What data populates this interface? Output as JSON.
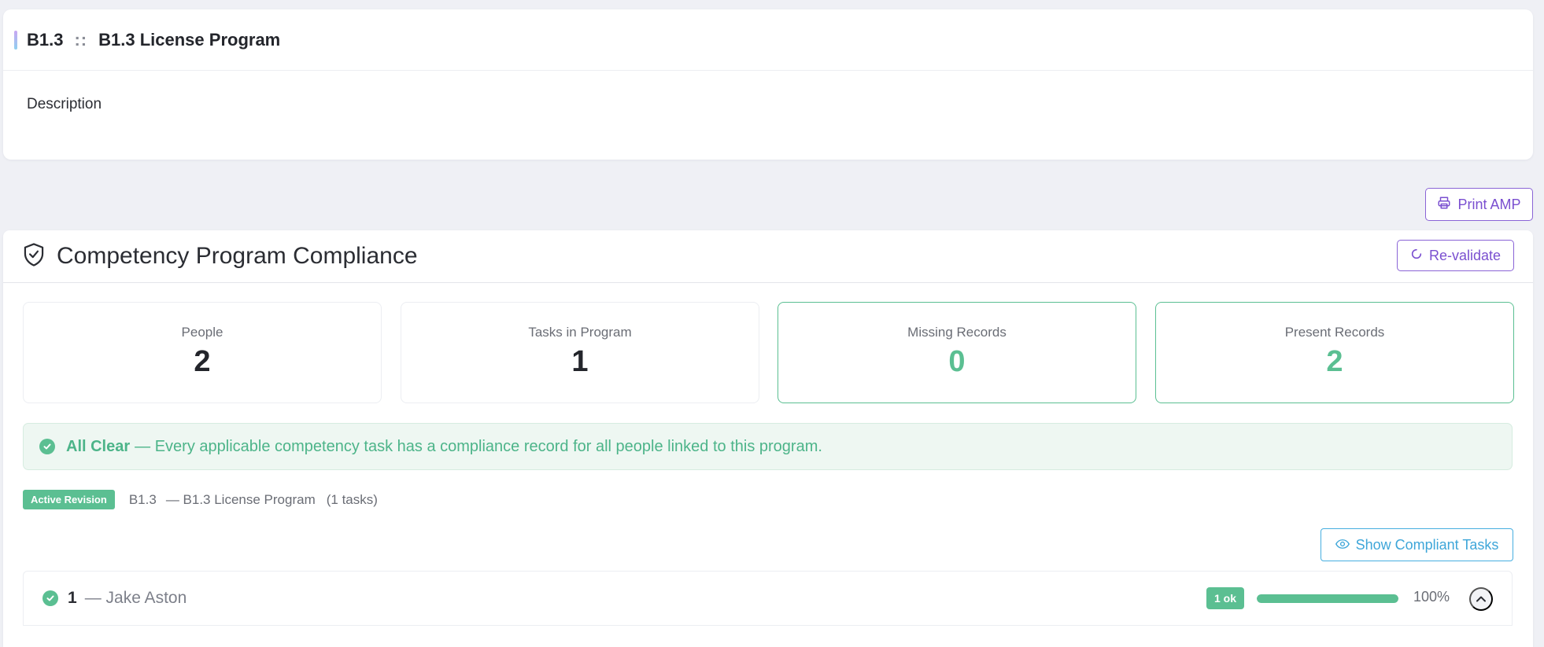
{
  "program": {
    "code": "B1.3",
    "separator": "::",
    "name": "B1.3 License Program",
    "description_label": "Description"
  },
  "toolbar": {
    "print_label": "Print AMP"
  },
  "compliance": {
    "title": "Competency Program Compliance",
    "revalidate_label": "Re-validate",
    "stats": {
      "people_label": "People",
      "people_value": "2",
      "tasks_label": "Tasks in Program",
      "tasks_value": "1",
      "missing_label": "Missing Records",
      "missing_value": "0",
      "present_label": "Present Records",
      "present_value": "2"
    },
    "alert": {
      "title": "All Clear",
      "message": "— Every applicable competency task has a compliance record for all people linked to this program."
    },
    "revision": {
      "badge": "Active Revision",
      "code": "B1.3",
      "name": "— B1.3 License Program",
      "tasks": "(1 tasks)"
    },
    "show_compliant_label": "Show Compliant Tasks",
    "people": [
      {
        "number": "1",
        "name": "— Jake Aston",
        "ok_badge": "1 ok",
        "progress": 100,
        "percent_label": "100%"
      }
    ]
  },
  "colors": {
    "accent_purple": "#7a4fd0",
    "success_green": "#5bbf92",
    "info_blue": "#3ea6d9"
  }
}
